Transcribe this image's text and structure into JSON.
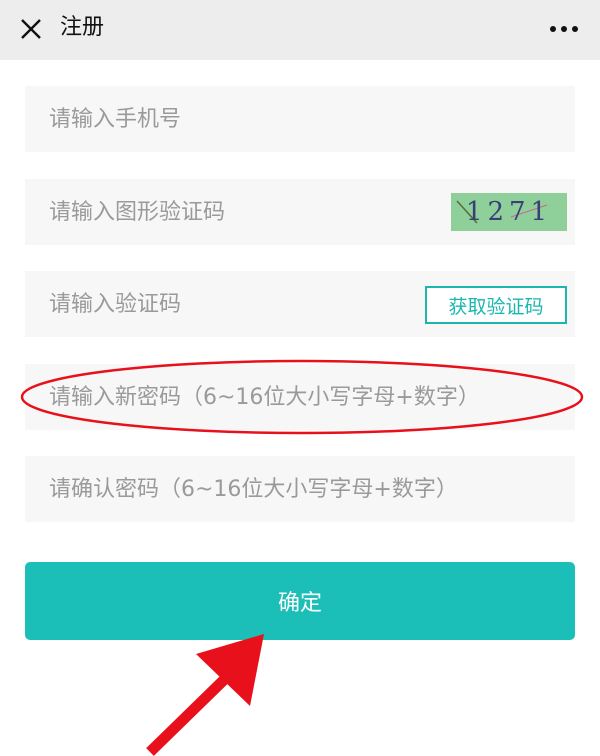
{
  "header": {
    "title": "注册",
    "close_icon": "close-icon",
    "more_icon": "more-icon"
  },
  "form": {
    "phone_placeholder": "请输入手机号",
    "captcha_placeholder": "请输入图形验证码",
    "captcha_image_text": "1271",
    "sms_code_placeholder": "请输入验证码",
    "get_code_label": "获取验证码",
    "new_password_placeholder": "请输入新密码（6~16位大小写字母+数字）",
    "confirm_password_placeholder": "请确认密码（6~16位大小写字母+数字）"
  },
  "confirm_label": "确定",
  "colors": {
    "accent": "#1bbfb7",
    "annotation": "#e8101a",
    "header_bg": "#ededed",
    "field_bg": "#f7f7f7"
  }
}
